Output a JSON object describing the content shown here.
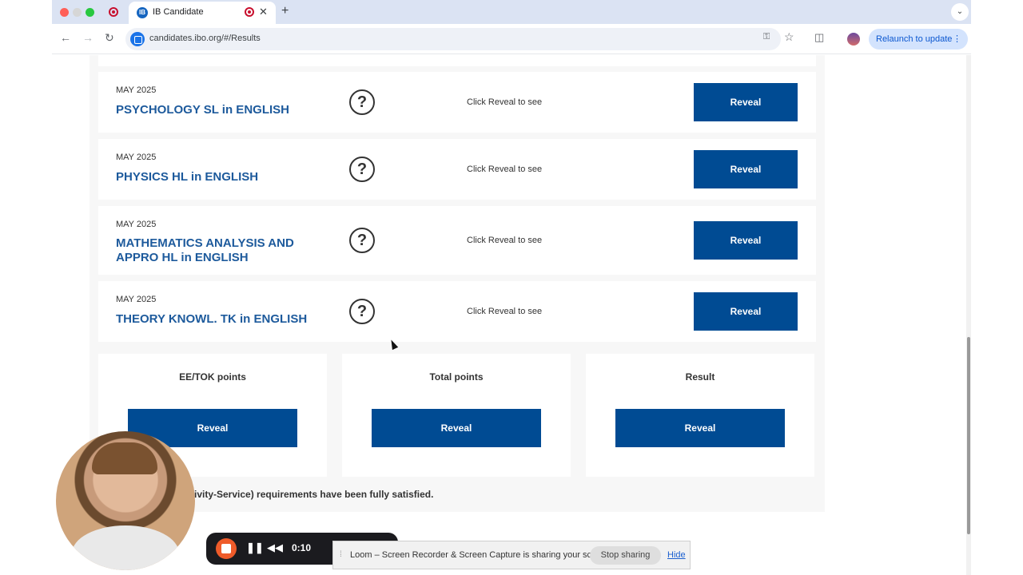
{
  "browser": {
    "tab_title": "IB Candidate",
    "tab_favicon_text": "IB",
    "url": "candidates.ibo.org/#/Results",
    "relaunch_label": "Relaunch to update"
  },
  "results": [
    {
      "session": "MAY 2025",
      "subject": "PSYCHOLOGY SL in ENGLISH",
      "hint": "Click Reveal to see",
      "button": "Reveal"
    },
    {
      "session": "MAY 2025",
      "subject": "PHYSICS HL in ENGLISH",
      "hint": "Click Reveal to see",
      "button": "Reveal"
    },
    {
      "session": "MAY 2025",
      "subject": "MATHEMATICS ANALYSIS AND APPRO HL in ENGLISH",
      "hint": "Click Reveal to see",
      "button": "Reveal"
    },
    {
      "session": "MAY 2025",
      "subject": "THEORY KNOWL. TK in ENGLISH",
      "hint": "Click Reveal to see",
      "button": "Reveal"
    }
  ],
  "summary": [
    {
      "label": "EE/TOK points",
      "button": "Reveal"
    },
    {
      "label": "Total points",
      "button": "Reveal"
    },
    {
      "label": "Result",
      "button": "Reveal"
    }
  ],
  "cas_note": "tivity-Service) requirements have been fully satisfied.",
  "loom": {
    "time": "0:10",
    "share_message": "Loom – Screen Recorder & Screen Capture is sharing your screen.",
    "stop_sharing_label": "Stop sharing",
    "hide_label": "Hide"
  },
  "colors": {
    "reveal_button": "#004b93",
    "subject_text": "#1d5a9c",
    "panel_bg": "#f7f7f7"
  }
}
